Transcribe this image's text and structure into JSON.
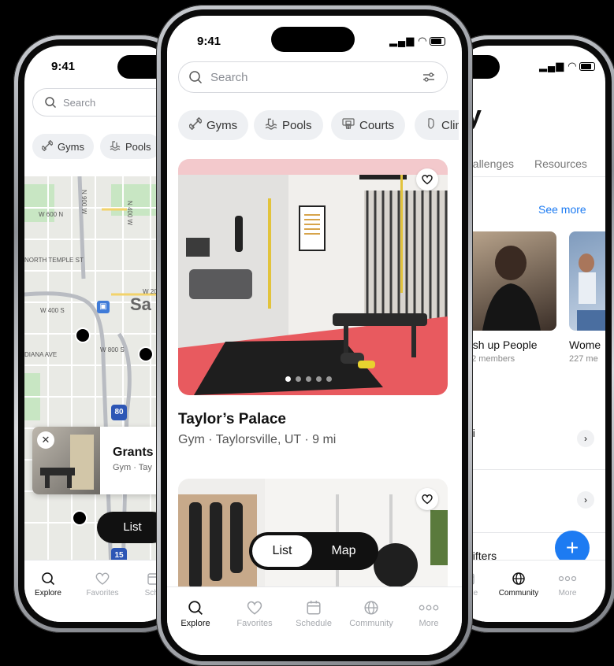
{
  "status": {
    "time": "9:41"
  },
  "left": {
    "search_placeholder": "Search",
    "chips": [
      {
        "label": "Gyms",
        "icon": "dumbbell-icon"
      },
      {
        "label": "Pools",
        "icon": "pool-icon"
      }
    ],
    "map_labels": [
      "W 600 N",
      "N 900 W",
      "N 400 W",
      "NORTH TEMPLE ST",
      "W 200 S",
      "Sa",
      "W 400 S",
      "W 800 S",
      "DIANA AVE",
      "80",
      "15"
    ],
    "result": {
      "title": "Grants",
      "subtitle": "Gym · Tay"
    },
    "list_button": "List",
    "tabs": [
      {
        "label": "Explore",
        "icon": "search-icon",
        "active": true
      },
      {
        "label": "Favorites",
        "icon": "heart-icon"
      },
      {
        "label": "Sche",
        "icon": "calendar-icon"
      }
    ]
  },
  "center": {
    "search_placeholder": "Search",
    "chips": [
      {
        "label": "Gyms",
        "icon": "dumbbell-icon"
      },
      {
        "label": "Pools",
        "icon": "pool-icon"
      },
      {
        "label": "Courts",
        "icon": "basketball-hoop-icon"
      },
      {
        "label": "Clim",
        "icon": "climbing-hold-icon"
      }
    ],
    "listing": {
      "title": "Taylor’s Palace",
      "subtitle": "Gym · Taylorsville, UT · 9 mi",
      "photo_index": 1,
      "photo_count": 5
    },
    "toggle": {
      "list": "List",
      "map": "Map",
      "selected": "List"
    },
    "tabs": [
      {
        "label": "Explore",
        "icon": "search-icon",
        "active": true
      },
      {
        "label": "Favorites",
        "icon": "heart-icon"
      },
      {
        "label": "Schedule",
        "icon": "calendar-icon"
      },
      {
        "label": "Community",
        "icon": "globe-icon"
      },
      {
        "label": "More",
        "icon": "more-icon"
      }
    ]
  },
  "right": {
    "heading_char": "y",
    "tabs_top": [
      "hallenges",
      "Resources"
    ],
    "see_more": "See more",
    "groups": [
      {
        "title": "ush up People",
        "members": "42 members"
      },
      {
        "title": "Wome",
        "members": "227 me"
      }
    ],
    "rows": [
      "ni",
      "",
      "Lifters"
    ],
    "fab": "+",
    "tabs": [
      {
        "label": "edule",
        "icon": "calendar-icon"
      },
      {
        "label": "Community",
        "icon": "globe-icon",
        "active": true
      },
      {
        "label": "More",
        "icon": "more-icon"
      }
    ]
  },
  "colors": {
    "accent": "#1d7bf2",
    "text": "#111111",
    "muted": "#8a8d94",
    "chip_bg": "#eef0f3",
    "mat_red": "#e85a5f"
  }
}
